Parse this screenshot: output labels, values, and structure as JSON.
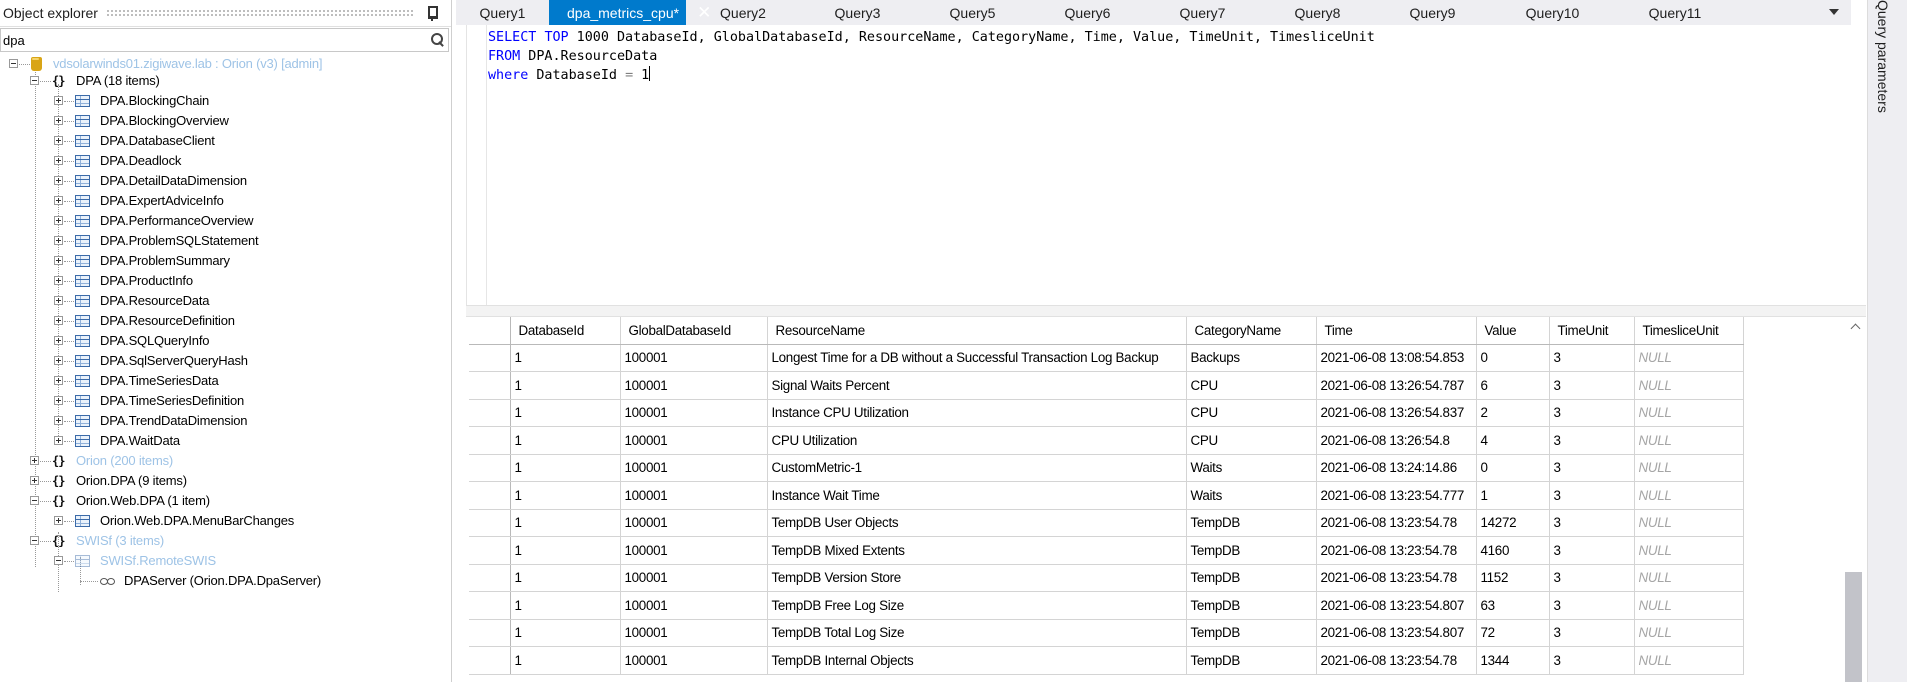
{
  "explorer": {
    "title": "Object explorer",
    "search_value": "dpa",
    "tree": [
      {
        "label": "vdsolarwinds01.zigiwave.lab : Orion (v3) [admin]",
        "type": "server",
        "faded": true
      },
      {
        "label": "DPA (18 items)",
        "type": "namespace"
      },
      {
        "label": "DPA.BlockingChain",
        "type": "table"
      },
      {
        "label": "DPA.BlockingOverview",
        "type": "table"
      },
      {
        "label": "DPA.DatabaseClient",
        "type": "table"
      },
      {
        "label": "DPA.Deadlock",
        "type": "table"
      },
      {
        "label": "DPA.DetailDataDimension",
        "type": "table"
      },
      {
        "label": "DPA.ExpertAdviceInfo",
        "type": "table"
      },
      {
        "label": "DPA.PerformanceOverview",
        "type": "table"
      },
      {
        "label": "DPA.ProblemSQLStatement",
        "type": "table"
      },
      {
        "label": "DPA.ProblemSummary",
        "type": "table"
      },
      {
        "label": "DPA.ProductInfo",
        "type": "table"
      },
      {
        "label": "DPA.ResourceData",
        "type": "table"
      },
      {
        "label": "DPA.ResourceDefinition",
        "type": "table"
      },
      {
        "label": "DPA.SQLQueryInfo",
        "type": "table"
      },
      {
        "label": "DPA.SqlServerQueryHash",
        "type": "table"
      },
      {
        "label": "DPA.TimeSeriesData",
        "type": "table"
      },
      {
        "label": "DPA.TimeSeriesDefinition",
        "type": "table"
      },
      {
        "label": "DPA.TrendDataDimension",
        "type": "table"
      },
      {
        "label": "DPA.WaitData",
        "type": "table"
      },
      {
        "label": "Orion (200 items)",
        "type": "namespace",
        "faded": true
      },
      {
        "label": "Orion.DPA (9 items)",
        "type": "namespace"
      },
      {
        "label": "Orion.Web.DPA (1 item)",
        "type": "namespace"
      },
      {
        "label": "Orion.Web.DPA.MenuBarChanges",
        "type": "table"
      },
      {
        "label": "SWISf (3 items)",
        "type": "namespace",
        "faded": true
      },
      {
        "label": "SWISf.RemoteSWIS",
        "type": "table",
        "faded": true
      },
      {
        "label": "DPAServer (Orion.DPA.DpaServer)",
        "type": "verb"
      }
    ]
  },
  "tabs": [
    {
      "label": "Query1"
    },
    {
      "label": "dpa_metrics_cpu*",
      "active": true
    },
    {
      "label": "Query2"
    },
    {
      "label": "Query3"
    },
    {
      "label": "Query5"
    },
    {
      "label": "Query6"
    },
    {
      "label": "Query7"
    },
    {
      "label": "Query8"
    },
    {
      "label": "Query9"
    },
    {
      "label": "Query10"
    },
    {
      "label": "Query11"
    }
  ],
  "tab_close_glyph": "✕",
  "editor": {
    "line1": {
      "kw1": "SELECT",
      "kw2": "TOP",
      "rest": " 1000 DatabaseId, GlobalDatabaseId, ResourceName, CategoryName, Time, Value, TimeUnit, TimesliceUnit"
    },
    "line2": {
      "kw": "FROM",
      "rest": " DPA.ResourceData"
    },
    "line3": {
      "kw": "where",
      "field": " DatabaseId ",
      "op": "=",
      "value": " 1"
    }
  },
  "grid": {
    "columns": [
      "DatabaseId",
      "GlobalDatabaseId",
      "ResourceName",
      "CategoryName",
      "Time",
      "Value",
      "TimeUnit",
      "TimesliceUnit"
    ],
    "rows": [
      [
        "1",
        "100001",
        "Longest Time for a DB without a Successful Transaction Log Backup",
        "Backups",
        "2021-06-08 13:08:54.853",
        "0",
        "3",
        "NULL"
      ],
      [
        "1",
        "100001",
        "Signal Waits Percent",
        "CPU",
        "2021-06-08 13:26:54.787",
        "6",
        "3",
        "NULL"
      ],
      [
        "1",
        "100001",
        "Instance CPU Utilization",
        "CPU",
        "2021-06-08 13:26:54.837",
        "2",
        "3",
        "NULL"
      ],
      [
        "1",
        "100001",
        "CPU Utilization",
        "CPU",
        "2021-06-08 13:26:54.8",
        "4",
        "3",
        "NULL"
      ],
      [
        "1",
        "100001",
        "CustomMetric-1",
        "Waits",
        "2021-06-08 13:24:14.86",
        "0",
        "3",
        "NULL"
      ],
      [
        "1",
        "100001",
        "Instance Wait Time",
        "Waits",
        "2021-06-08 13:23:54.777",
        "1",
        "3",
        "NULL"
      ],
      [
        "1",
        "100001",
        "TempDB User Objects",
        "TempDB",
        "2021-06-08 13:23:54.78",
        "14272",
        "3",
        "NULL"
      ],
      [
        "1",
        "100001",
        "TempDB Mixed Extents",
        "TempDB",
        "2021-06-08 13:23:54.78",
        "4160",
        "3",
        "NULL"
      ],
      [
        "1",
        "100001",
        "TempDB Version Store",
        "TempDB",
        "2021-06-08 13:23:54.78",
        "1152",
        "3",
        "NULL"
      ],
      [
        "1",
        "100001",
        "TempDB Free Log Size",
        "TempDB",
        "2021-06-08 13:23:54.807",
        "63",
        "3",
        "NULL"
      ],
      [
        "1",
        "100001",
        "TempDB Total Log Size",
        "TempDB",
        "2021-06-08 13:23:54.807",
        "72",
        "3",
        "NULL"
      ],
      [
        "1",
        "100001",
        "TempDB Internal Objects",
        "TempDB",
        "2021-06-08 13:23:54.78",
        "1344",
        "3",
        "NULL"
      ]
    ]
  },
  "side_panel": {
    "label": "Query parameters"
  },
  "colors": {
    "accent": "#007acc",
    "keyword": "#0000ff",
    "null_text": "#a5a5a5",
    "faded_tree": "#9ec3e6"
  }
}
